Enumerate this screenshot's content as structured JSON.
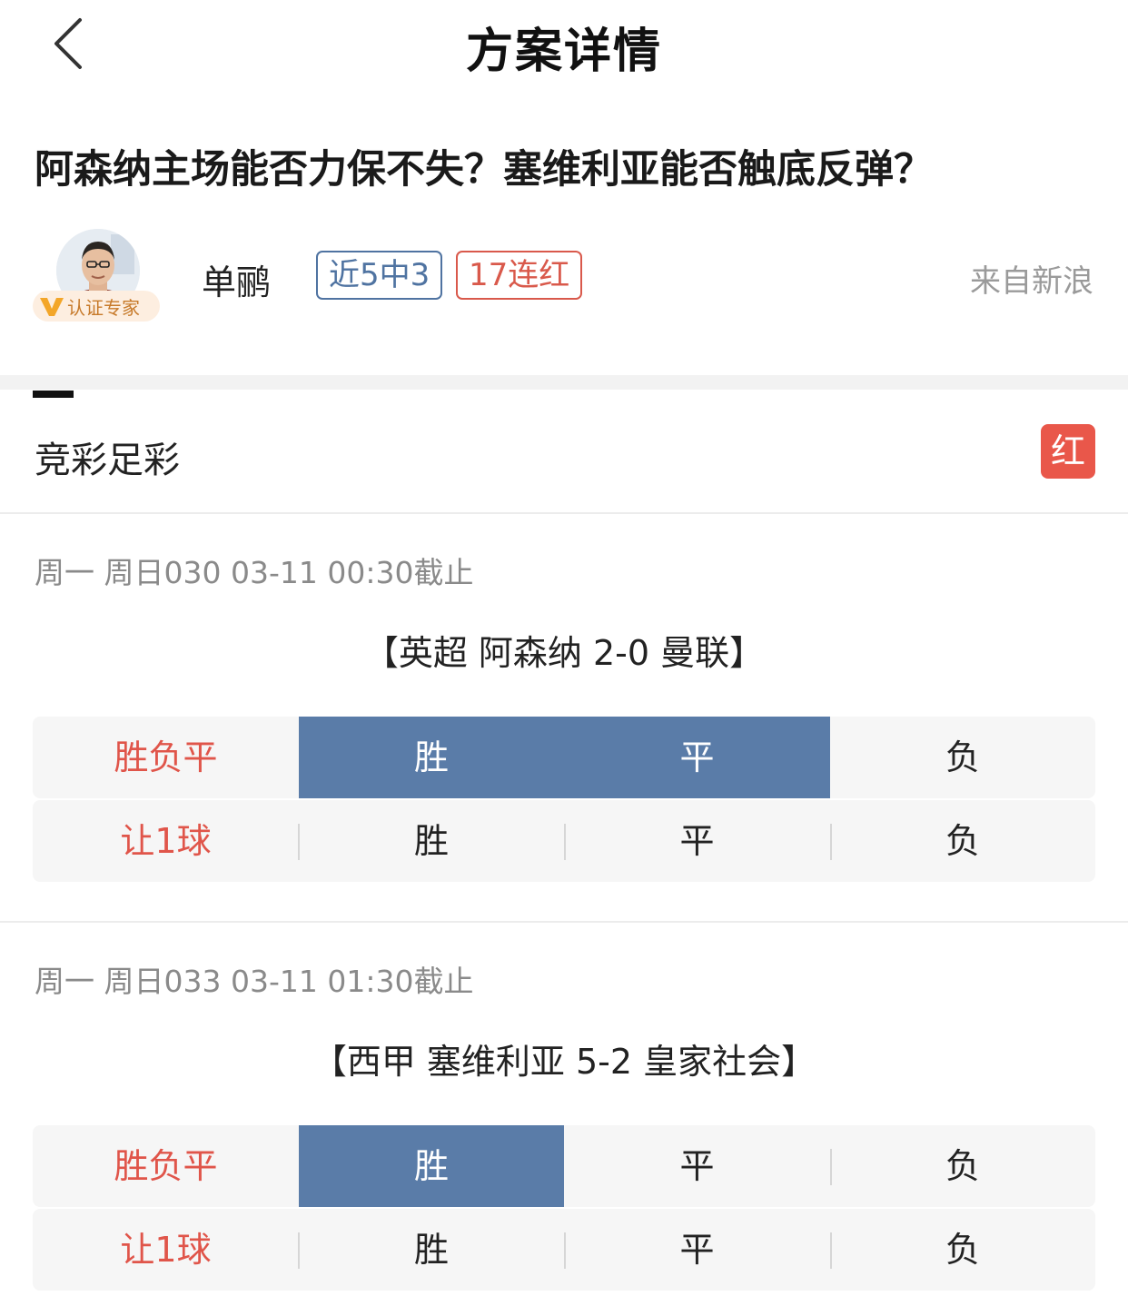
{
  "nav": {
    "title": "方案详情"
  },
  "article": {
    "headline": "阿森纳主场能否力保不失？塞维利亚能否触底反弹？"
  },
  "author": {
    "badge_label": "认证专家",
    "name": "单鹂",
    "tags": [
      {
        "text": "近5中3",
        "color": "#4f73a1"
      },
      {
        "text": "17连红",
        "color": "#d9594b"
      }
    ],
    "source": "来自新浪"
  },
  "section": {
    "title": "竞彩足彩",
    "result_badge": "红",
    "result_color": "#e9574a"
  },
  "matches": [
    {
      "meta": "周一 周日030 03-11 00:30截止",
      "title": "【英超 阿森纳 2-0 曼联】",
      "rows": [
        {
          "label": "胜负平",
          "options": [
            "胜",
            "平",
            "负"
          ],
          "selected": [
            true,
            true,
            false
          ]
        },
        {
          "label": "让1球",
          "options": [
            "胜",
            "平",
            "负"
          ],
          "selected": [
            false,
            false,
            false
          ]
        }
      ]
    },
    {
      "meta": "周一 周日033 03-11 01:30截止",
      "title": "【西甲 塞维利亚 5-2 皇家社会】",
      "rows": [
        {
          "label": "胜负平",
          "options": [
            "胜",
            "平",
            "负"
          ],
          "selected": [
            true,
            false,
            false
          ]
        },
        {
          "label": "让1球",
          "options": [
            "胜",
            "平",
            "负"
          ],
          "selected": [
            false,
            false,
            false
          ]
        }
      ]
    }
  ],
  "colors": {
    "accent_red": "#e0554a",
    "selected_blue": "#5a7ca8",
    "tag_blue": "#4f73a1"
  },
  "icons": [
    "back-chevron-icon",
    "verified-v-icon"
  ]
}
